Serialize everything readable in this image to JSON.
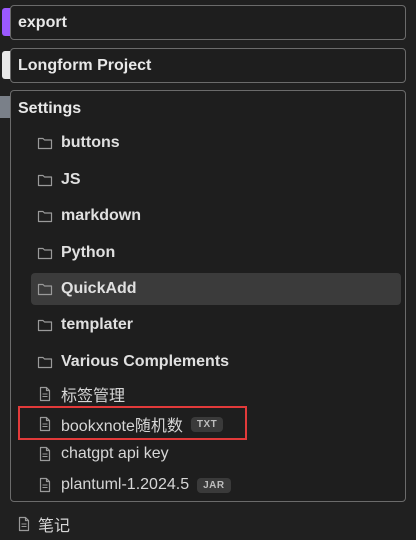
{
  "colors": {
    "export_accent": "#9b59ff",
    "longform_accent": "#e8e8e8",
    "highlight_border": "#e23a3a"
  },
  "folders": {
    "export": "export",
    "longform": "Longform Project",
    "settings": "Settings"
  },
  "settings_children": [
    {
      "label": "buttons",
      "type": "folder",
      "icon": "folder-icon"
    },
    {
      "label": "JS",
      "type": "folder",
      "icon": "folder-icon"
    },
    {
      "label": "markdown",
      "type": "folder",
      "icon": "folder-icon"
    },
    {
      "label": "Python",
      "type": "folder",
      "icon": "folder-icon"
    },
    {
      "label": "QuickAdd",
      "type": "folder",
      "icon": "folder-icon",
      "active": true
    },
    {
      "label": "templater",
      "type": "folder",
      "icon": "folder-icon"
    },
    {
      "label": "Various Complements",
      "type": "folder",
      "icon": "folder-icon"
    },
    {
      "label": "标签管理",
      "type": "file",
      "icon": "file-icon"
    },
    {
      "label": "bookxnote随机数",
      "type": "file",
      "icon": "file-icon",
      "tag": "TXT"
    },
    {
      "label": "chatgpt api key",
      "type": "file",
      "icon": "file-icon"
    },
    {
      "label": "plantuml-1.2024.5",
      "type": "file",
      "icon": "file-icon",
      "tag": "JAR"
    }
  ],
  "bottom_item": {
    "label": "笔记",
    "icon": "file-icon"
  }
}
